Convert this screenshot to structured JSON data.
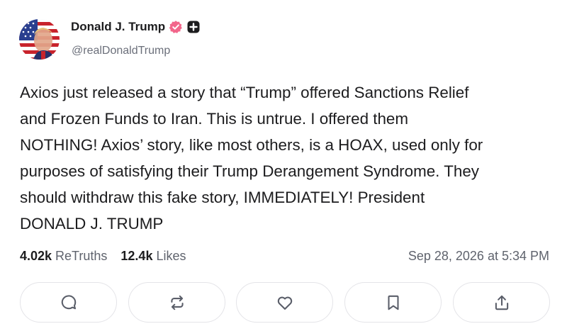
{
  "post": {
    "author": {
      "display_name": "Donald J. Trump",
      "handle": "@realDonaldTrump",
      "verified": true,
      "avatar_icon": "profile-avatar"
    },
    "text": "Axios just released a story that “Trump” offered Sanctions Relief\nand Frozen Funds to Iran. This is untrue. I offered them\nNOTHING! Axios’ story, like most others, is a HOAX, used only for\npurposes of satisfying their Trump Derangement Syndrome. They\nshould withdraw this fake story, IMMEDIATELY! President\nDONALD J. TRUMP",
    "stats": {
      "retruths_count": "4.02k",
      "retruths_label": "ReTruths",
      "likes_count": "12.4k",
      "likes_label": "Likes"
    },
    "timestamp": "Sep 28, 2026 at 5:34 PM"
  },
  "actions": [
    {
      "name": "reply",
      "icon": "comment-icon"
    },
    {
      "name": "retruth",
      "icon": "repost-icon"
    },
    {
      "name": "like",
      "icon": "heart-icon"
    },
    {
      "name": "bookmark",
      "icon": "bookmark-icon"
    },
    {
      "name": "share",
      "icon": "share-icon"
    }
  ],
  "colors": {
    "text_primary": "#1c1c1e",
    "text_secondary": "#6b6f7a",
    "verified_badge": "#f2668b",
    "border": "#e4e4e8"
  }
}
